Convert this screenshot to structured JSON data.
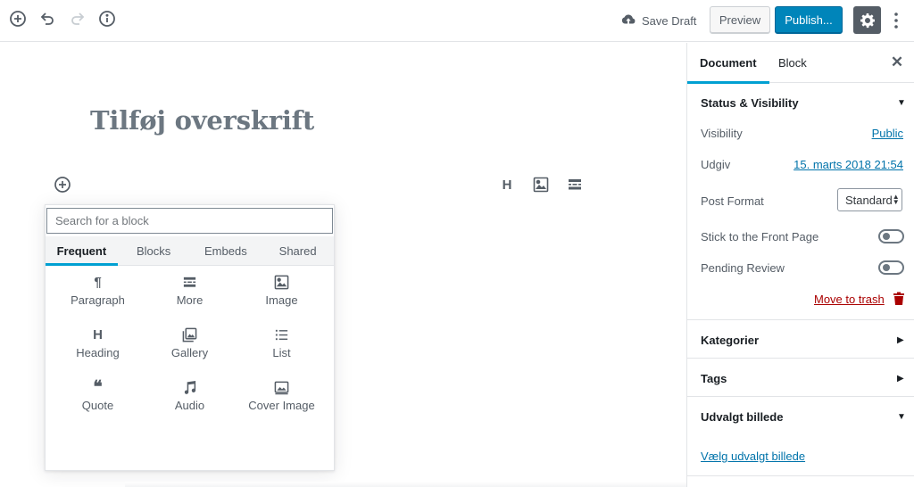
{
  "toolbar": {
    "save_draft": "Save Draft",
    "preview": "Preview",
    "publish": "Publish..."
  },
  "editor": {
    "title_placeholder": "Tilføj overskrift"
  },
  "inserter": {
    "search_placeholder": "Search for a block",
    "tabs": [
      {
        "label": "Frequent",
        "active": true
      },
      {
        "label": "Blocks",
        "active": false
      },
      {
        "label": "Embeds",
        "active": false
      },
      {
        "label": "Shared",
        "active": false
      }
    ],
    "blocks": [
      {
        "label": "Paragraph",
        "icon": "paragraph-icon"
      },
      {
        "label": "More",
        "icon": "more-icon"
      },
      {
        "label": "Image",
        "icon": "image-icon"
      },
      {
        "label": "Heading",
        "icon": "heading-icon"
      },
      {
        "label": "Gallery",
        "icon": "gallery-icon"
      },
      {
        "label": "List",
        "icon": "list-icon"
      },
      {
        "label": "Quote",
        "icon": "quote-icon"
      },
      {
        "label": "Audio",
        "icon": "audio-icon"
      },
      {
        "label": "Cover Image",
        "icon": "cover-image-icon"
      }
    ],
    "heading_glyph": "H",
    "paragraph_glyph": "¶",
    "quote_glyph": "❝"
  },
  "quick_inserter": {
    "heading_glyph": "H"
  },
  "sidebar": {
    "tab_document": "Document",
    "tab_block": "Block",
    "status_visibility": {
      "title": "Status & Visibility",
      "visibility_label": "Visibility",
      "visibility_value": "Public",
      "publish_label": "Udgiv",
      "publish_value": "15. marts 2018 21:54",
      "post_format_label": "Post Format",
      "post_format_value": "Standard",
      "sticky_label": "Stick to the Front Page",
      "pending_label": "Pending Review",
      "trash_label": "Move to trash"
    },
    "categories_title": "Kategorier",
    "tags_title": "Tags",
    "featured_image_title": "Udvalgt billede",
    "featured_image_link": "Vælg udvalgt billede"
  },
  "colors": {
    "accent": "#00a0d2",
    "primary_button": "#0085ba",
    "link": "#0073aa",
    "danger": "#aa0000"
  }
}
